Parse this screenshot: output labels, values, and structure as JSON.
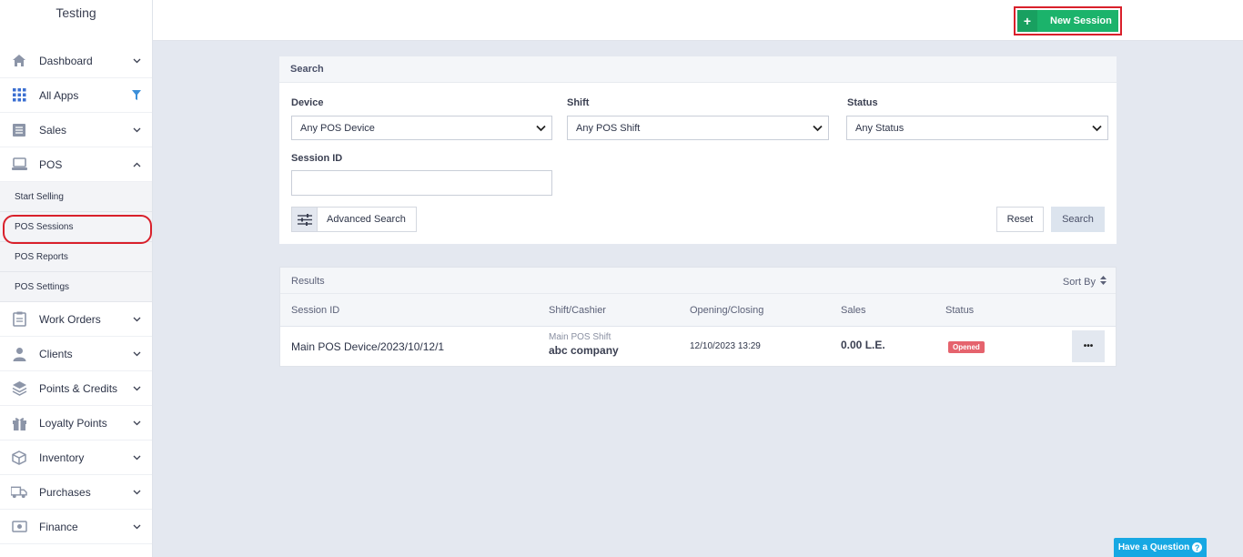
{
  "sidebar": {
    "brand": "Testing",
    "items_top": [
      {
        "label": "Dashboard",
        "icon": "home-icon"
      },
      {
        "label": "All Apps",
        "icon": "grid-icon"
      },
      {
        "label": "Sales",
        "icon": "sales-icon"
      },
      {
        "label": "POS",
        "icon": "pos-icon"
      }
    ],
    "pos_sub": [
      "Start Selling",
      "POS Sessions",
      "POS Reports",
      "POS Settings"
    ],
    "items_bottom": [
      {
        "label": "Work Orders",
        "icon": "clipboard-icon"
      },
      {
        "label": "Clients",
        "icon": "user-icon"
      },
      {
        "label": "Points & Credits",
        "icon": "layers-icon"
      },
      {
        "label": "Loyalty Points",
        "icon": "gift-icon"
      },
      {
        "label": "Inventory",
        "icon": "box-icon"
      },
      {
        "label": "Purchases",
        "icon": "truck-icon"
      },
      {
        "label": "Finance",
        "icon": "money-icon"
      }
    ]
  },
  "topbar": {
    "new_session": "New Session",
    "plus": "+"
  },
  "search": {
    "title": "Search",
    "device_label": "Device",
    "device_value": "Any POS Device",
    "shift_label": "Shift",
    "shift_value": "Any POS Shift",
    "status_label": "Status",
    "status_value": "Any Status",
    "session_id_label": "Session ID",
    "session_id_value": "",
    "advanced": "Advanced Search",
    "reset": "Reset",
    "search": "Search"
  },
  "results": {
    "title": "Results",
    "sort_by": "Sort By",
    "columns": [
      "Session ID",
      "Shift/Cashier",
      "Opening/Closing",
      "Sales",
      "Status"
    ],
    "rows": [
      {
        "session_id": "Main POS Device/2023/10/12/1",
        "shift": "Main POS Shift",
        "cashier": "abc company",
        "opening": "12/10/2023 13:29",
        "sales": "0.00 L.E.",
        "status": "Opened",
        "more": "•••"
      }
    ]
  },
  "help": {
    "label": "Have a Question",
    "q": "?"
  },
  "colors": {
    "accent_green": "#1bb36b",
    "highlight_red": "#d9202b",
    "badge_red": "#e5636d",
    "help_blue": "#17a8e3"
  }
}
